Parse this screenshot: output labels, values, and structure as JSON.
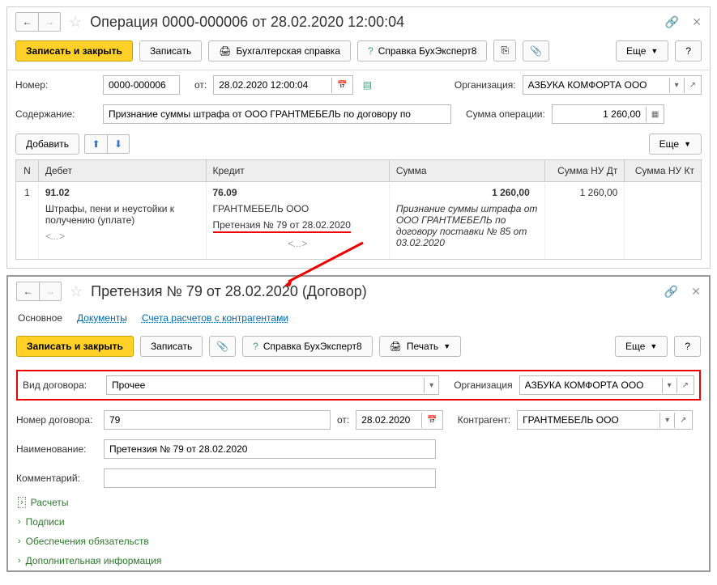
{
  "window1": {
    "title": "Операция 0000-000006 от 28.02.2020 12:00:04",
    "toolbar": {
      "save_close": "Записать и закрыть",
      "save": "Записать",
      "acct_ref": "Бухгалтерская справка",
      "help_ref": "Справка БухЭксперт8",
      "more": "Еще",
      "help": "?"
    },
    "form": {
      "number_label": "Номер:",
      "number": "0000-000006",
      "from_label": "от:",
      "date": "28.02.2020 12:00:04",
      "org_label": "Организация:",
      "org": "АЗБУКА КОМФОРТА ООО",
      "content_label": "Содержание:",
      "content": "Признание суммы штрафа от ООО ГРАНТМЕБЕЛЬ по договору по",
      "sum_label": "Сумма операции:",
      "sum": "1 260,00"
    },
    "table": {
      "add": "Добавить",
      "more": "Еще",
      "headers": {
        "n": "N",
        "debit": "Дебет",
        "credit": "Кредит",
        "sum": "Сумма",
        "nudt": "Сумма НУ Дт",
        "nukt": "Сумма НУ Кт"
      },
      "row": {
        "n": "1",
        "debit_acc": "91.02",
        "debit_desc": "Штрафы, пени и неустойки к получению (уплате)",
        "debit_ph": "<...>",
        "credit_acc": "76.09",
        "credit_name": "ГРАНТМЕБЕЛЬ ООО",
        "credit_claim": "Претензия № 79 от 28.02.2020",
        "credit_ph": "<...>",
        "sum_val": "1 260,00",
        "sum_desc": "Признание суммы штрафа от ООО ГРАНТМЕБЕЛЬ по договору поставки № 85 от 03.02.2020",
        "nudt": "1 260,00",
        "nukt": ""
      }
    }
  },
  "window2": {
    "title": "Претензия № 79 от 28.02.2020 (Договор)",
    "tabs": {
      "main": "Основное",
      "docs": "Документы",
      "accounts": "Счета расчетов с контрагентами"
    },
    "toolbar": {
      "save_close": "Записать и закрыть",
      "save": "Записать",
      "help_ref": "Справка БухЭксперт8",
      "print": "Печать",
      "more": "Еще",
      "help": "?"
    },
    "form": {
      "type_label": "Вид договора:",
      "type": "Прочее",
      "org_label": "Организация",
      "org": "АЗБУКА КОМФОРТА ООО",
      "num_label": "Номер договора:",
      "num": "79",
      "from_label": "от:",
      "date": "28.02.2020",
      "counter_label": "Контрагент:",
      "counter": "ГРАНТМЕБЕЛЬ ООО",
      "name_label": "Наименование:",
      "name": "Претензия № 79 от 28.02.2020",
      "comment_label": "Комментарий:",
      "comment": ""
    },
    "expanders": {
      "calc": "Расчеты",
      "sign": "Подписи",
      "secure": "Обеспечения обязательств",
      "extra": "Дополнительная информация"
    }
  }
}
